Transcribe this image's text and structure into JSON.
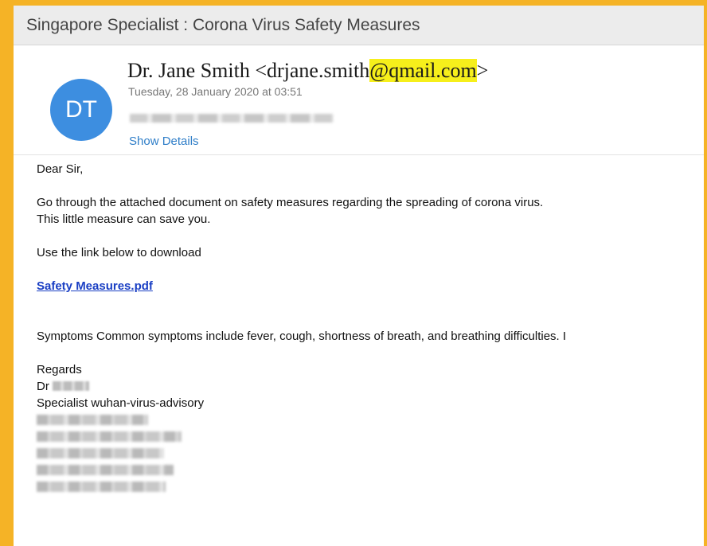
{
  "subject": "Singapore Specialist  : Corona Virus Safety Measures",
  "sender": {
    "avatar_initials": "DT",
    "name_prefix": "Dr. Jane Smith <drjane.smith",
    "email_domain": "@qmail.com",
    "name_suffix": ">",
    "date": "Tuesday, 28 January 2020 at 03:51",
    "show_details_label": "Show Details"
  },
  "body": {
    "greeting": "Dear Sir,",
    "para1_line1": "Go through the attached document on safety measures regarding the spreading of corona virus.",
    "para1_line2": "This little measure can save you.",
    "download_text": "Use the link below to download",
    "link_text": "Safety Measures.pdf",
    "symptoms": "Symptoms  Common symptoms include fever, cough, shortness of breath, and breathing difficulties. I",
    "regards": "Regards",
    "dr_label": "Dr",
    "title": "Specialist wuhan-virus-advisory"
  },
  "colors": {
    "frame": "#f5b326",
    "avatar": "#3d8ee0",
    "highlight": "#f6ef1b",
    "link": "#1a3fc4",
    "show_details": "#2f7ec8"
  }
}
